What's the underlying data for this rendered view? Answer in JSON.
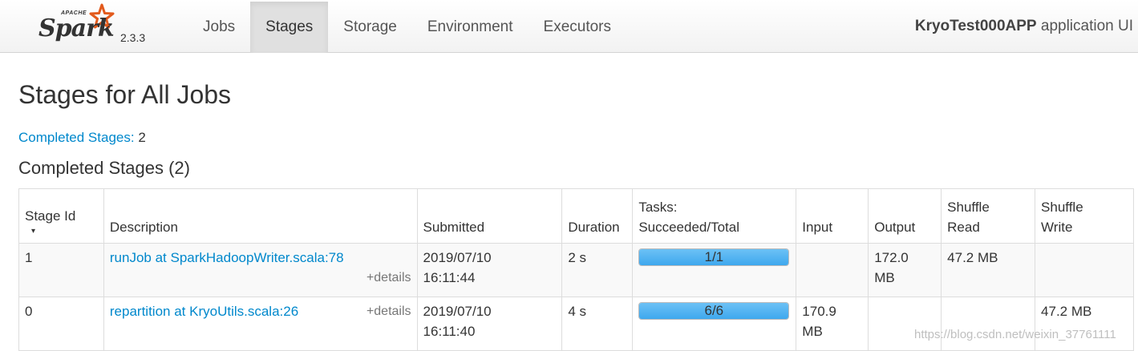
{
  "brand": {
    "apache": "APACHE",
    "name": "Spark",
    "version": "2.3.3"
  },
  "nav": {
    "tabs": [
      {
        "label": "Jobs",
        "active": false
      },
      {
        "label": "Stages",
        "active": true
      },
      {
        "label": "Storage",
        "active": false
      },
      {
        "label": "Environment",
        "active": false
      },
      {
        "label": "Executors",
        "active": false
      }
    ],
    "app_name": "KryoTest000APP",
    "app_suffix": " application UI"
  },
  "page": {
    "title": "Stages for All Jobs",
    "summary_label": "Completed Stages:",
    "summary_value": "2",
    "section_title": "Completed Stages (2)"
  },
  "table": {
    "headers": {
      "stage_id": "Stage Id",
      "description": "Description",
      "submitted": "Submitted",
      "duration": "Duration",
      "tasks_line1": "Tasks:",
      "tasks_line2": "Succeeded/Total",
      "input": "Input",
      "output": "Output",
      "shuffle_read_1": "Shuffle",
      "shuffle_read_2": "Read",
      "shuffle_write_1": "Shuffle",
      "shuffle_write_2": "Write"
    },
    "sort_indicator": "▾",
    "rows": [
      {
        "stage_id": "1",
        "description": "runJob at SparkHadoopWriter.scala:78",
        "details": "+details",
        "submitted_date": "2019/07/10",
        "submitted_time": "16:11:44",
        "duration": "2 s",
        "tasks": "1/1",
        "tasks_fraction": 1.0,
        "input_1": "",
        "input_2": "",
        "output_1": "172.0",
        "output_2": "MB",
        "shuffle_read": "47.2 MB",
        "shuffle_write": ""
      },
      {
        "stage_id": "0",
        "description": "repartition at KryoUtils.scala:26",
        "details": "+details",
        "submitted_date": "2019/07/10",
        "submitted_time": "16:11:40",
        "duration": "4 s",
        "tasks": "6/6",
        "tasks_fraction": 1.0,
        "input_1": "170.9",
        "input_2": "MB",
        "output_1": "",
        "output_2": "",
        "shuffle_read": "",
        "shuffle_write": "47.2 MB"
      }
    ]
  },
  "watermark": "https://blog.csdn.net/weixin_37761111",
  "colors": {
    "link": "#0088cc",
    "progress": "#3ea8ee",
    "star": "#e25a1c"
  }
}
